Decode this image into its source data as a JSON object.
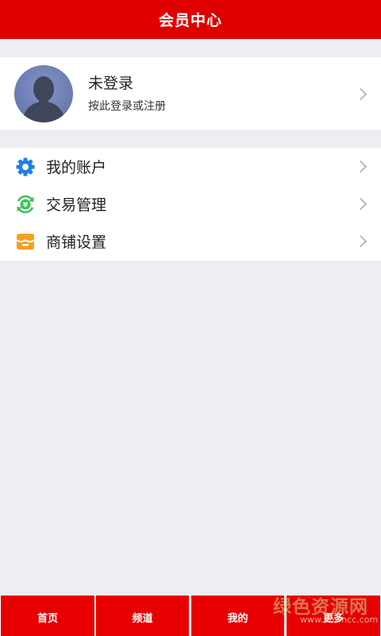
{
  "header": {
    "title": "会员中心"
  },
  "profile": {
    "name": "未登录",
    "subtitle": "按此登录或注册",
    "avatar_icon": "user-silhouette-icon"
  },
  "menu": {
    "items": [
      {
        "label": "我的账户",
        "icon": "gear-icon",
        "color": "#1E7FE8"
      },
      {
        "label": "交易管理",
        "icon": "yuan-exchange-icon",
        "color": "#3DBF5A"
      },
      {
        "label": "商铺设置",
        "icon": "shop-icon",
        "color": "#F5A021"
      }
    ]
  },
  "tabbar": {
    "tabs": [
      {
        "label": "首页"
      },
      {
        "label": "频道"
      },
      {
        "label": "我的"
      },
      {
        "label": "更多"
      }
    ]
  },
  "watermark": {
    "brand": "绿色资源网",
    "url": "www.downcc.com"
  },
  "colors": {
    "accent": "#E00000",
    "background": "#EEEEF2"
  }
}
